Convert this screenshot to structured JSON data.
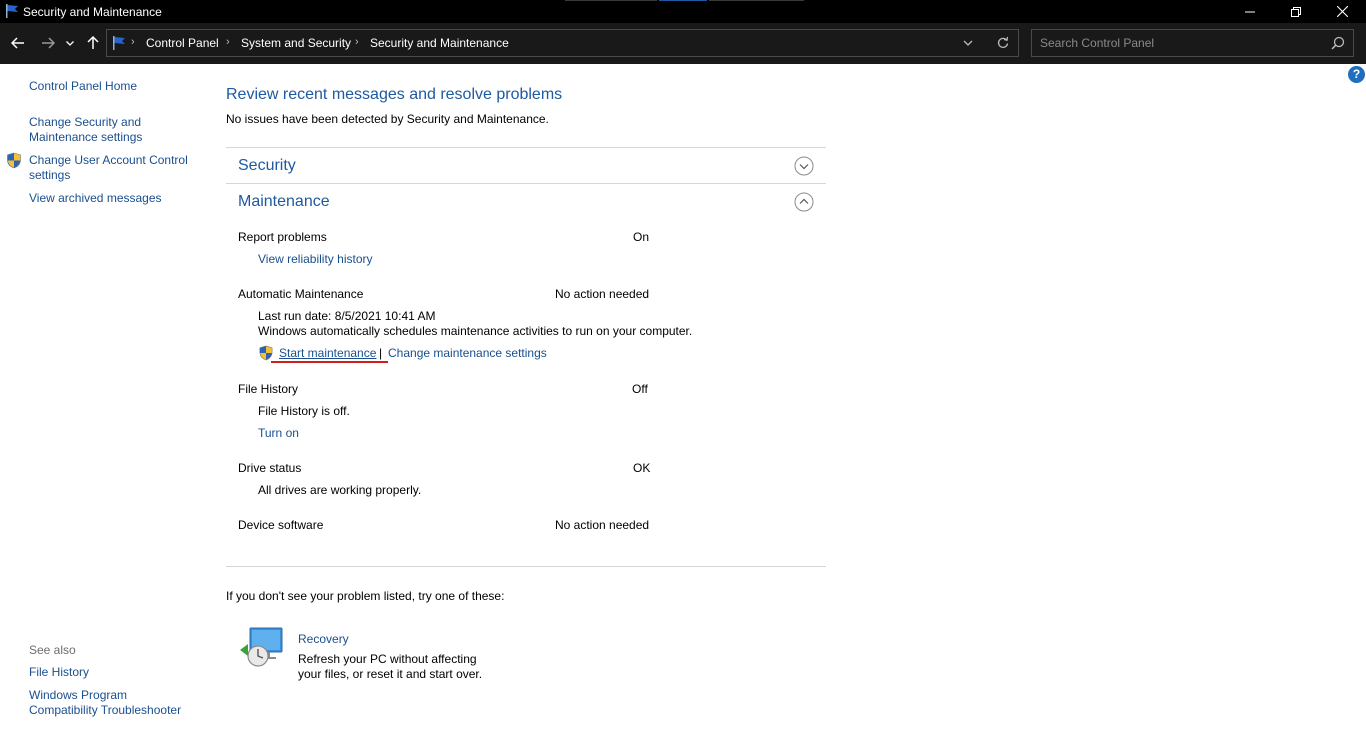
{
  "window": {
    "title": "Security and Maintenance"
  },
  "address": {
    "crumbs": [
      "Control Panel",
      "System and Security",
      "Security and Maintenance"
    ],
    "search_placeholder": "Search Control Panel"
  },
  "help": {
    "label": "?"
  },
  "sidebar": {
    "home": "Control Panel Home",
    "change_security_line1": "Change Security and",
    "change_security_line2": "Maintenance settings",
    "change_uac_line1": "Change User Account Control",
    "change_uac_line2": "settings",
    "archived": "View archived messages",
    "see_also": "See also",
    "file_history": "File History",
    "compat_line1": "Windows Program",
    "compat_line2": "Compatibility Troubleshooter"
  },
  "main": {
    "heading": "Review recent messages and resolve problems",
    "subheading": "No issues have been detected by Security and Maintenance.",
    "security_title": "Security",
    "maintenance_title": "Maintenance",
    "report_problems": {
      "label": "Report problems",
      "status": "On",
      "link": "View reliability history"
    },
    "auto_maintenance": {
      "label": "Automatic Maintenance",
      "status": "No action needed",
      "last_run": "Last run date: 8/5/2021 10:41 AM",
      "description": "Windows automatically schedules maintenance activities to run on your computer.",
      "start_link": "Start maintenance",
      "separator": "|",
      "change_link": "Change maintenance settings"
    },
    "file_history": {
      "label": "File History",
      "status": "Off",
      "description": "File History is off.",
      "link": "Turn on"
    },
    "drive_status": {
      "label": "Drive status",
      "status": "OK",
      "description": "All drives are working properly."
    },
    "device_software": {
      "label": "Device software",
      "status": "No action needed"
    },
    "try_these": "If you don't see your problem listed, try one of these:",
    "recovery": {
      "title": "Recovery",
      "line1": "Refresh your PC without affecting",
      "line2": "your files, or reset it and start over."
    }
  },
  "colors": {
    "link": "#1a4f8f",
    "heading": "#1e5aa0",
    "titlebar": "#000000",
    "navbar": "#191919",
    "annotation": "#d21d1d"
  }
}
